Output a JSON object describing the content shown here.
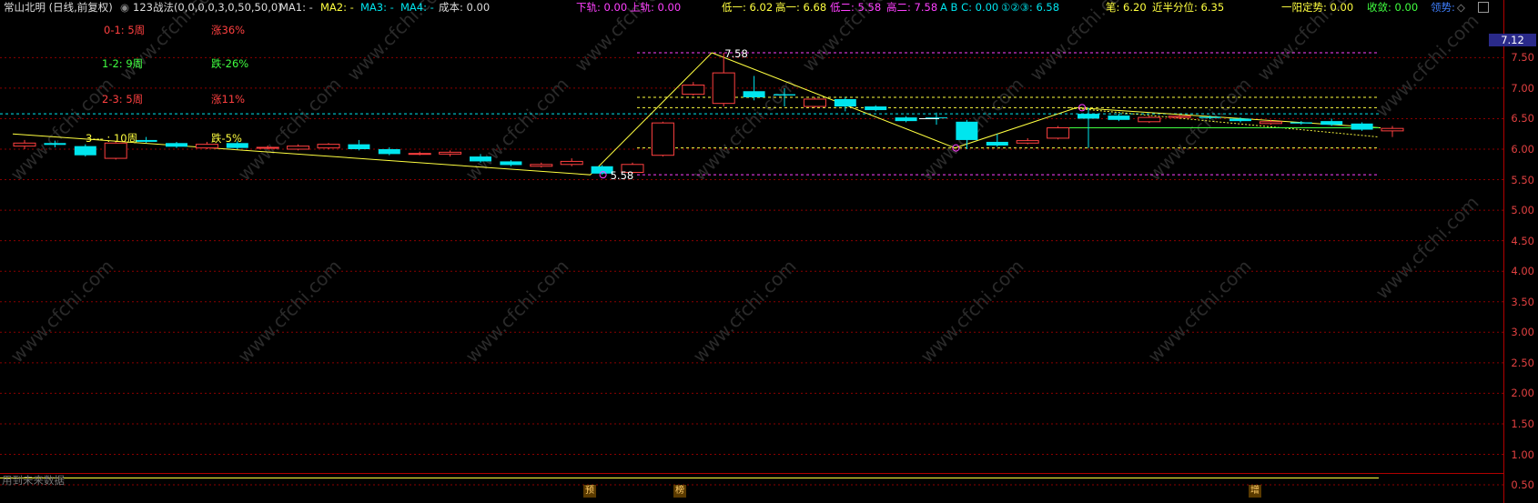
{
  "header": {
    "stock_title": "常山北明 (日线,前复权)",
    "indicator_name": "123战法(0,0,0,0,3,0,50,50,0)",
    "ma1": "MA1: -",
    "ma2": "MA2: -",
    "ma3": "MA3: -",
    "ma4": "MA4: -",
    "cost": "成本: 0.00",
    "lower_rail": "下轨: 0.00",
    "upper_rail": "上轨: 0.00",
    "low1": "低一: 6.02",
    "high1": "高一: 6.68",
    "low2": "低二: 5.58",
    "high2": "高二: 7.58",
    "abc": "A B C: 0.00",
    "circled123": "①②③: 6.58",
    "bi": "笔: 6.20",
    "near_half": "近半分位: 6.35",
    "yiyang": "一阳定势: 0.00",
    "shoulian": "收敛: 0.00",
    "lingshi": "领势:"
  },
  "legend": {
    "row1_label": "0-1:  5周",
    "row1_value": "涨36%",
    "row2_label": "1-2:  9周",
    "row2_value": "跌-26%",
    "row3_label": "2-3:  5周",
    "row3_value": "涨11%",
    "row4_label": "3---  :  10周",
    "row4_value": "跌-5%"
  },
  "annotations": {
    "high_label": "7.58",
    "low_label": "5.58"
  },
  "price_axis": {
    "ticks": [
      "7.50",
      "7.00",
      "6.50",
      "6.00",
      "5.50",
      "5.00",
      "4.50",
      "4.00",
      "3.50",
      "3.00",
      "2.50",
      "2.00",
      "1.50",
      "1.00",
      "0.50"
    ],
    "current_price": "7.12"
  },
  "bottom": {
    "label": "用到未来数据",
    "markers": [
      "预",
      "榜",
      "增"
    ]
  },
  "watermark": "www.cfchi.com",
  "colors": {
    "up": "#ff4040",
    "down": "#00e5ee",
    "yellow": "#ffff40",
    "magenta": "#ff40ff",
    "background": "#000000",
    "grid": "#8b0000"
  },
  "chart_data": {
    "type": "candlestick",
    "ylim": [
      0,
      7.7
    ],
    "candles": [
      {
        "o": 6.05,
        "c": 6.1,
        "h": 6.15,
        "l": 6.0
      },
      {
        "o": 6.1,
        "c": 6.07,
        "h": 6.14,
        "l": 6.03
      },
      {
        "o": 6.05,
        "c": 5.9,
        "h": 6.08,
        "l": 5.88
      },
      {
        "o": 5.85,
        "c": 6.1,
        "h": 6.12,
        "l": 5.83
      },
      {
        "o": 6.15,
        "c": 6.12,
        "h": 6.2,
        "l": 6.1
      },
      {
        "o": 6.1,
        "c": 6.04,
        "h": 6.12,
        "l": 6.02
      },
      {
        "o": 6.02,
        "c": 6.08,
        "h": 6.12,
        "l": 6.0
      },
      {
        "o": 6.1,
        "c": 6.02,
        "h": 6.13,
        "l": 6.0
      },
      {
        "o": 6.02,
        "c": 6.03,
        "h": 6.06,
        "l": 6.0
      },
      {
        "o": 6.0,
        "c": 6.05,
        "h": 6.08,
        "l": 5.98
      },
      {
        "o": 6.02,
        "c": 6.08,
        "h": 6.1,
        "l": 6.0
      },
      {
        "o": 6.08,
        "c": 6.0,
        "h": 6.15,
        "l": 5.98
      },
      {
        "o": 6.0,
        "c": 5.92,
        "h": 6.03,
        "l": 5.9
      },
      {
        "o": 5.92,
        "c": 5.93,
        "h": 5.96,
        "l": 5.9
      },
      {
        "o": 5.92,
        "c": 5.95,
        "h": 5.98,
        "l": 5.88
      },
      {
        "o": 5.88,
        "c": 5.8,
        "h": 5.92,
        "l": 5.78
      },
      {
        "o": 5.8,
        "c": 5.74,
        "h": 5.82,
        "l": 5.72
      },
      {
        "o": 5.72,
        "c": 5.75,
        "h": 5.78,
        "l": 5.7
      },
      {
        "o": 5.75,
        "c": 5.8,
        "h": 5.85,
        "l": 5.72
      },
      {
        "o": 5.72,
        "c": 5.6,
        "h": 5.74,
        "l": 5.58
      },
      {
        "o": 5.62,
        "c": 5.75,
        "h": 5.78,
        "l": 5.6
      },
      {
        "o": 5.9,
        "c": 6.43,
        "h": 6.45,
        "l": 5.88
      },
      {
        "o": 6.9,
        "c": 7.05,
        "h": 7.1,
        "l": 6.88
      },
      {
        "o": 6.75,
        "c": 7.25,
        "h": 7.58,
        "l": 6.7
      },
      {
        "o": 6.95,
        "c": 6.85,
        "h": 7.2,
        "l": 6.8
      },
      {
        "o": 6.9,
        "c": 6.88,
        "h": 7.0,
        "l": 6.7
      },
      {
        "o": 6.7,
        "c": 6.82,
        "h": 6.85,
        "l": 6.68
      },
      {
        "o": 6.82,
        "c": 6.7,
        "h": 6.85,
        "l": 6.62
      },
      {
        "o": 6.7,
        "c": 6.64,
        "h": 6.72,
        "l": 6.62
      },
      {
        "o": 6.52,
        "c": 6.46,
        "h": 6.54,
        "l": 6.44
      },
      {
        "o": 6.52,
        "c": 6.51,
        "h": 6.6,
        "l": 6.4
      },
      {
        "o": 6.45,
        "c": 6.15,
        "h": 6.48,
        "l": 6.0
      },
      {
        "o": 6.12,
        "c": 6.06,
        "h": 6.25,
        "l": 6.04
      },
      {
        "o": 6.1,
        "c": 6.14,
        "h": 6.18,
        "l": 6.08
      },
      {
        "o": 6.18,
        "c": 6.35,
        "h": 6.38,
        "l": 6.16
      },
      {
        "o": 6.58,
        "c": 6.5,
        "h": 6.68,
        "l": 6.02
      },
      {
        "o": 6.55,
        "c": 6.48,
        "h": 6.58,
        "l": 6.46
      },
      {
        "o": 6.45,
        "c": 6.52,
        "h": 6.55,
        "l": 6.43
      },
      {
        "o": 6.52,
        "c": 6.54,
        "h": 6.56,
        "l": 6.5
      },
      {
        "o": 6.53,
        "c": 6.51,
        "h": 6.55,
        "l": 6.49
      },
      {
        "o": 6.5,
        "c": 6.46,
        "h": 6.52,
        "l": 6.44
      },
      {
        "o": 6.42,
        "c": 6.45,
        "h": 6.48,
        "l": 6.4
      },
      {
        "o": 6.44,
        "c": 6.42,
        "h": 6.46,
        "l": 6.4
      },
      {
        "o": 6.46,
        "c": 6.4,
        "h": 6.5,
        "l": 6.38
      },
      {
        "o": 6.42,
        "c": 6.32,
        "h": 6.44,
        "l": 6.3
      },
      {
        "o": 6.3,
        "c": 6.34,
        "h": 6.38,
        "l": 6.2
      }
    ],
    "zigzag": [
      [
        0,
        6.25
      ],
      [
        19,
        5.58
      ],
      [
        23,
        7.58
      ],
      [
        31,
        6.02
      ],
      [
        35,
        6.68
      ],
      [
        45,
        6.35
      ]
    ],
    "hlines": [
      {
        "price": 7.58,
        "color": "#ff40ff"
      },
      {
        "price": 6.85,
        "color": "#ffff40"
      },
      {
        "price": 6.68,
        "color": "#ffff40"
      },
      {
        "price": 6.58,
        "color": "#00e5ee"
      },
      {
        "price": 6.02,
        "color": "#ffff40"
      },
      {
        "price": 5.58,
        "color": "#ff40ff"
      }
    ]
  }
}
